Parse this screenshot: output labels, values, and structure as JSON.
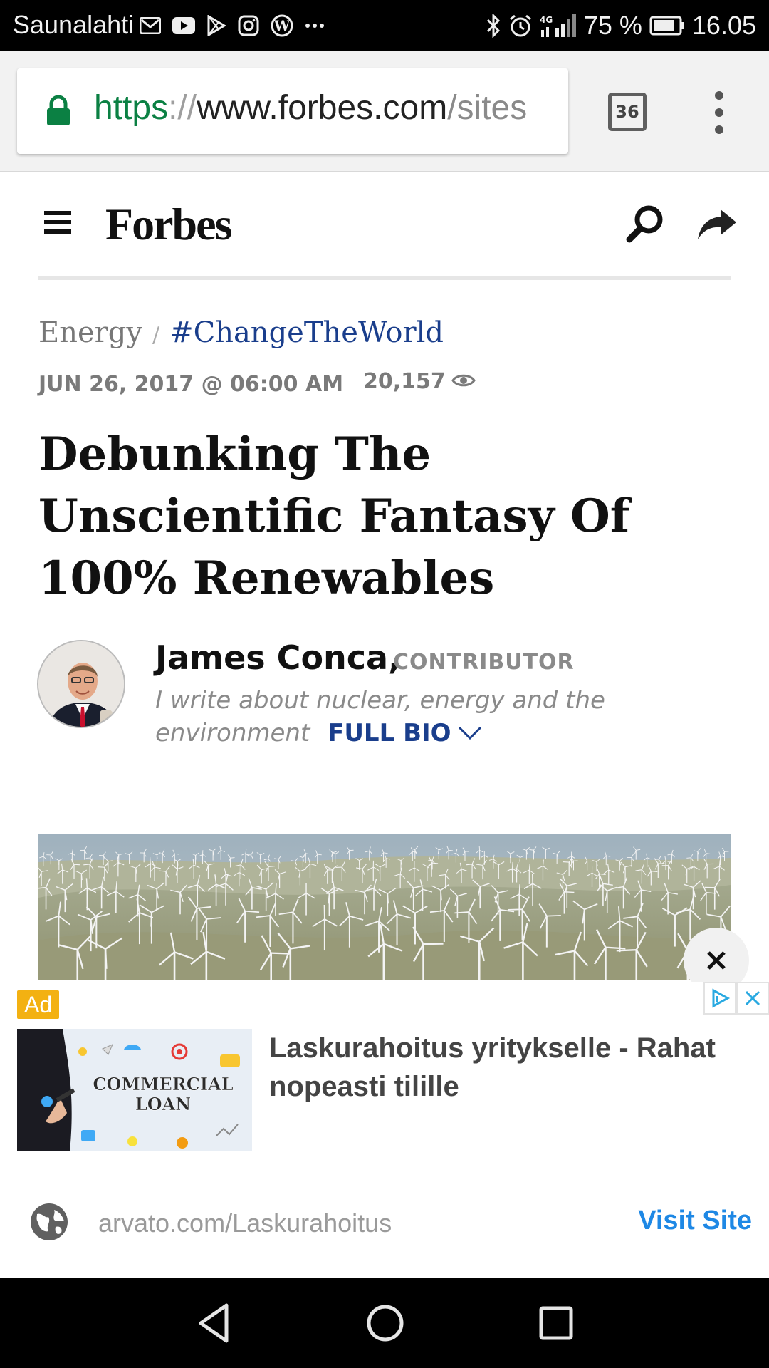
{
  "status_bar": {
    "carrier": "Saunalahti",
    "battery": "75 %",
    "time": "16.05",
    "left_icons": [
      "gmail-icon",
      "youtube-icon",
      "play-store-icon",
      "instagram-icon",
      "wordpress-icon",
      "more-icon"
    ],
    "right_icons": [
      "bluetooth-icon",
      "alarm-icon",
      "signal-4g-icon",
      "battery-icon"
    ]
  },
  "browser": {
    "url_scheme": "https",
    "url_sep": "://",
    "url_host": "www.forbes.com",
    "url_path": "/sites",
    "tab_count": "36"
  },
  "site": {
    "logo": "Forbes"
  },
  "article": {
    "section": "Energy",
    "separator": "/",
    "tag": "#ChangeTheWorld",
    "date": "JUN 26, 2017 @ 06:00 AM",
    "views": "20,157",
    "headline": "Debunking The Unscientific Fantasy Of 100% Renewables"
  },
  "author": {
    "name": "James Conca,",
    "role": "CONTRIBUTOR",
    "bio": "I write about nuclear, energy and the environment",
    "full_bio_label": "FULL BIO"
  },
  "ad": {
    "badge": "Ad",
    "image_text_line1": "COMMERCIAL",
    "image_text_line2": "LOAN",
    "title": "Laskurahoitus yritykselle - Rahat nopeasti tilille",
    "domain": "arvato.com/Laskurahoitus",
    "cta": "Visit Site"
  },
  "colors": {
    "link_blue": "#1a3e8c",
    "https_green": "#0b8043",
    "ad_badge": "#f3b112",
    "cta_blue": "#1e88e5"
  }
}
